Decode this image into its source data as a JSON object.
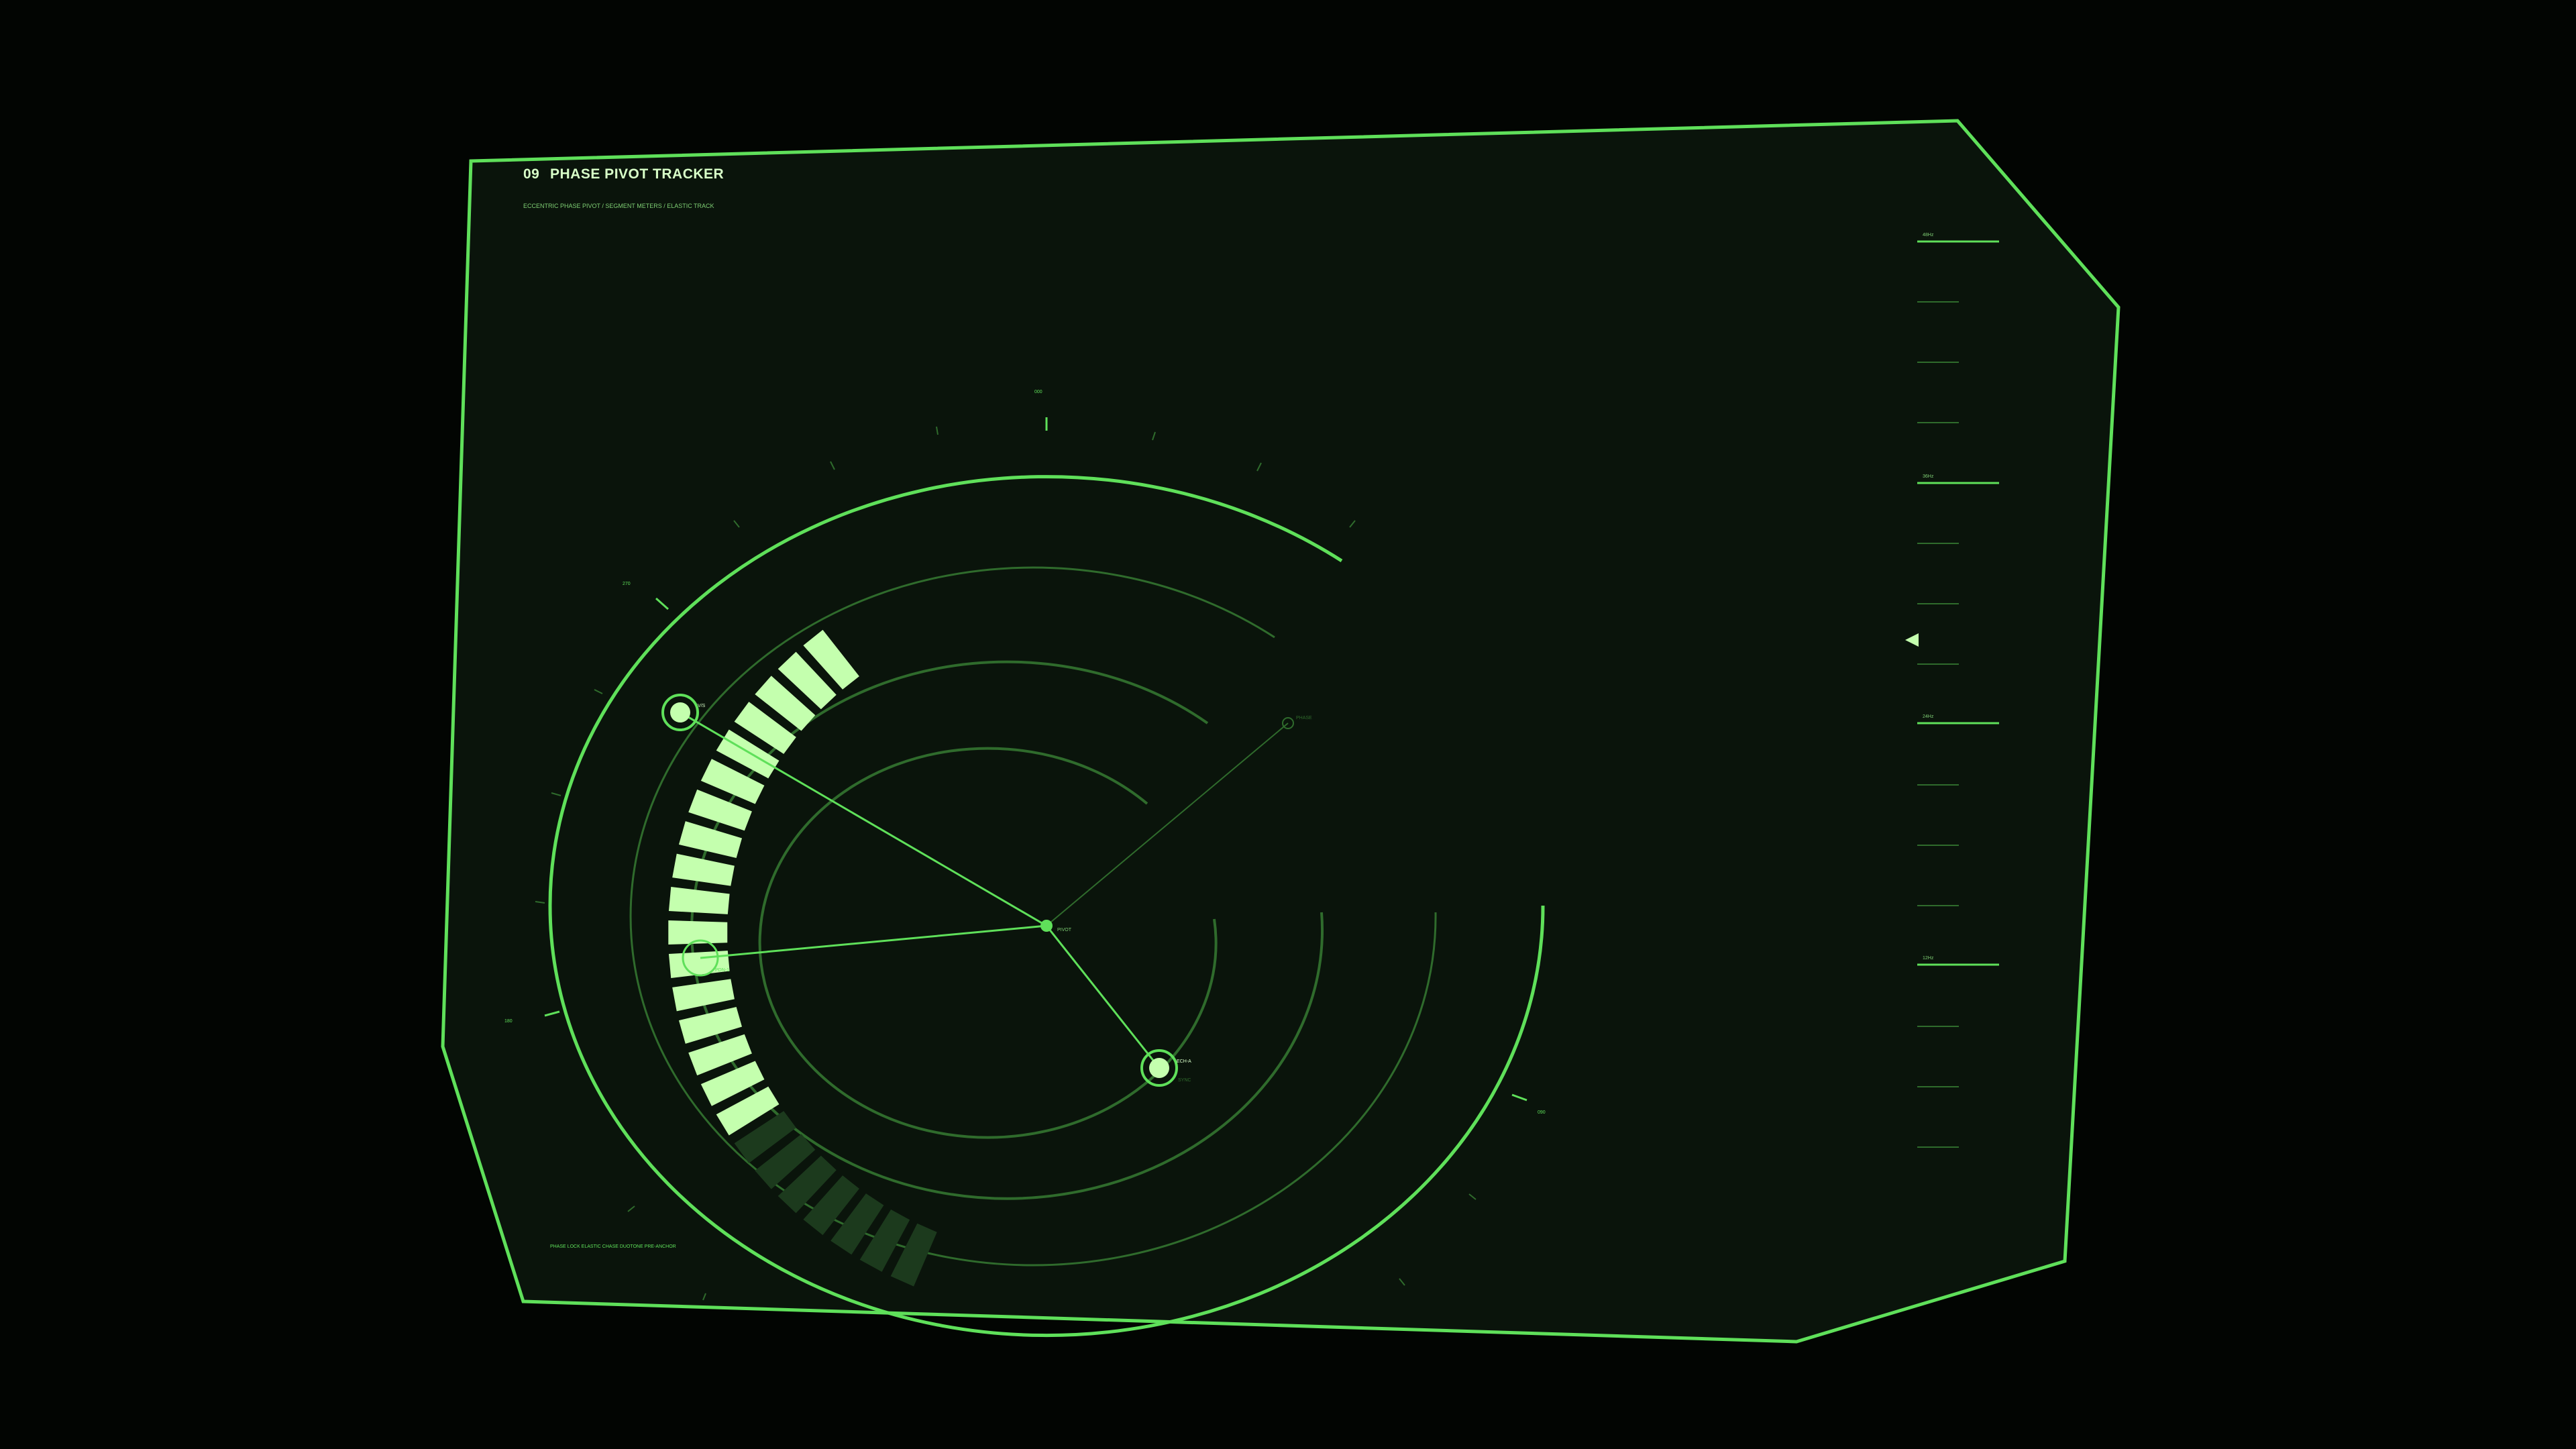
{
  "header": {
    "index": "09",
    "title": "PHASE PIVOT TRACKER",
    "subtitle": "ECCENTRIC PHASE PIVOT / SEGMENT METERS / ELASTIC TRACK"
  },
  "footer": {
    "status": "PHASE LOCK  ELASTIC CHASE  DUOTONE PRE-ANCHOR"
  },
  "nodes": [
    {
      "id": "node-pivot",
      "label": "PIVOT"
    },
    {
      "id": "node-upper-left",
      "label": "V/S"
    },
    {
      "id": "node-left",
      "label": "PDN-1"
    },
    {
      "id": "node-lower-right",
      "label": "ECH-A",
      "sub": "SYNC"
    },
    {
      "id": "node-upper-right",
      "label": "PHASE"
    }
  ],
  "segment_meter": {
    "total_segments": 24,
    "lit_segments": 17,
    "fraction_lit": 0.708
  },
  "side_scale": {
    "labels": [
      "48Hz",
      "36Hz",
      "24Hz",
      "12Hz"
    ],
    "pointer": "level-marker"
  },
  "dial_labels": {
    "top": "000",
    "left": "270",
    "far_left": "180",
    "right": "090"
  },
  "colors": {
    "background": "#020502",
    "panel_fill": "#0a140b",
    "accent": "#5fe05a",
    "accent_dim": "#2f6b2c",
    "segment_lit": "#c4ffae",
    "segment_dim": "#1c3a1d",
    "text_bright": "#d8ffc8"
  }
}
